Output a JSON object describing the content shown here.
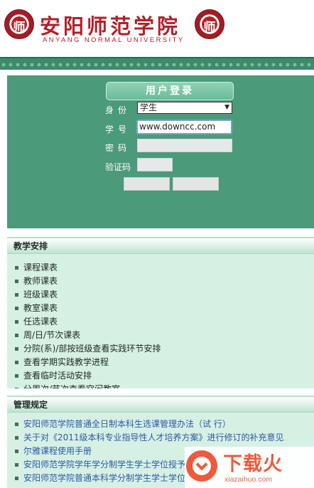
{
  "header": {
    "seal_glyph": "师",
    "logo_cn": "安阳师范学院",
    "logo_en": "ANYANG NORMAL UNIVERSITY"
  },
  "login": {
    "title": "用户登录",
    "identity_label": "身份",
    "identity_value": "学生",
    "student_id_label": "学号",
    "student_id_value": "www.downcc.com",
    "password_label": "密码",
    "captcha_label": "验证码"
  },
  "teaching": {
    "title": "教学安排",
    "items": [
      "课程课表",
      "教师课表",
      "班级课表",
      "教室课表",
      "任选课表",
      "周/日/节次课表",
      "分院(系)/部按班级查看实践环节安排",
      "查看学期实践教学进程",
      "查看临时活动安排",
      "分周次/节次查看空闲教室"
    ]
  },
  "rules": {
    "title": "管理规定",
    "items": [
      "安阳师范学院普通全日制本科生选课管理办法（试 行）",
      "关于对《2011级本科专业指导性人才培养方案》进行修订的补充意见",
      "尔雅课程使用手册",
      "安阳师范学院学年学分制学生学士学位授予",
      "安阳师范学院普通本科学分制学生学士学位"
    ]
  },
  "watermark": {
    "cn": "下载火",
    "en": "xiazaihuo.com"
  },
  "colors": {
    "green_panel": "#4b9a79",
    "section_bg": "#d7f0e4",
    "brand_red": "#b3202a",
    "watermark_orange": "#ef5a3c"
  }
}
